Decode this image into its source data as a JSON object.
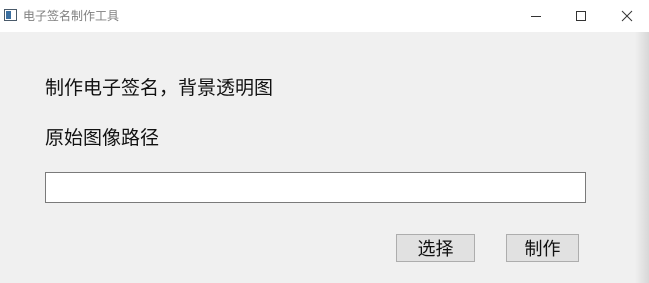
{
  "window": {
    "title": "电子签名制作工具"
  },
  "titlebar": {
    "buttons": {
      "minimize_icon": "minimize-icon",
      "maximize_icon": "maximize-icon",
      "close_icon": "close-icon"
    }
  },
  "main": {
    "heading": "制作电子签名，背景透明图",
    "path_label": "原始图像路径",
    "path_input": {
      "value": "",
      "placeholder": ""
    },
    "select_button": "选择",
    "make_button": "制作"
  },
  "colors": {
    "window_bg": "#f0f0f0",
    "titlebar_bg": "#ffffff",
    "button_bg": "#e1e1e1",
    "button_border": "#adadad"
  }
}
